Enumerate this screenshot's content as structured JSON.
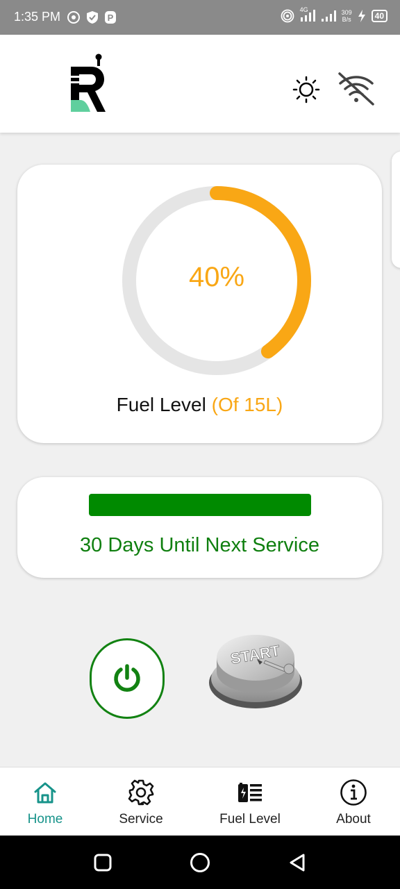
{
  "status_bar": {
    "time": "1:35 PM",
    "network_label": "4G",
    "net_speed_value": "309",
    "net_speed_unit": "B/s",
    "battery": "40",
    "icons": [
      "whatsapp-icon",
      "shield-icon",
      "parking-icon",
      "hotspot-icon",
      "signal-icon",
      "signal-icon-2",
      "charging-icon",
      "battery-icon"
    ]
  },
  "app_bar": {
    "logo": "r-logo",
    "theme_icon": "sun-icon",
    "connection_icon": "wifi-off-icon"
  },
  "fuel": {
    "percent_text": "40%",
    "percent_value": 40,
    "label": "Fuel Level",
    "capacity": "(Of 15L)"
  },
  "service": {
    "progress": 1.0,
    "text": "30 Days Until Next Service"
  },
  "controls": {
    "power_icon": "power-icon",
    "start_button_label": "START"
  },
  "nav": {
    "items": [
      {
        "label": "Home",
        "icon": "home-icon",
        "active": true
      },
      {
        "label": "Service",
        "icon": "gear-icon",
        "active": false
      },
      {
        "label": "Fuel Level",
        "icon": "fuel-station-icon",
        "active": false
      },
      {
        "label": "About",
        "icon": "info-icon",
        "active": false
      }
    ]
  },
  "colors": {
    "accent": "#f9a715",
    "service_green": "#008a00",
    "power_green": "#128212",
    "nav_active": "#17938a",
    "logo_green": "#5fcf9e"
  }
}
